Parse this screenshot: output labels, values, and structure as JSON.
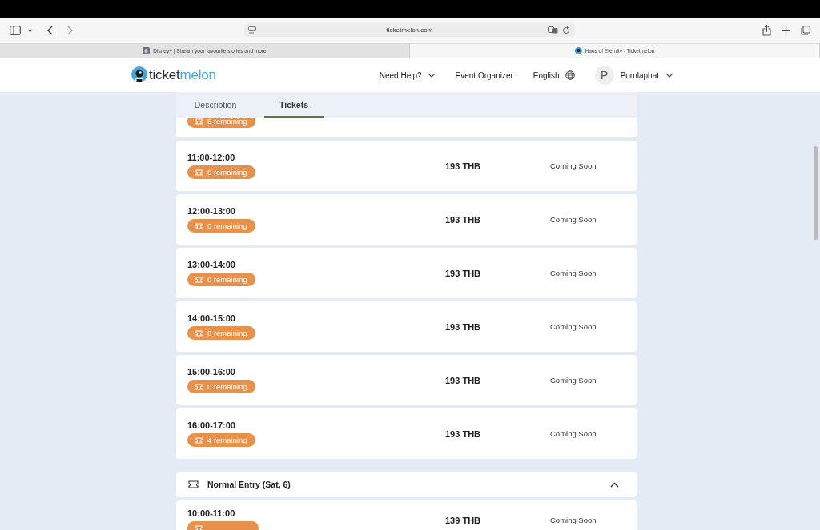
{
  "browser": {
    "url": "ticketmelon.com",
    "tabs": [
      {
        "title": "Disney+ | Stream your favourite stories and more",
        "selected": false
      },
      {
        "title": "Haus of Eternity - Ticketmelon",
        "selected": true
      }
    ]
  },
  "header": {
    "logo": [
      "ticket",
      "melon"
    ],
    "nav": [
      {
        "label": "Need Help?",
        "kind": "dropdown"
      },
      {
        "label": "Event Organizer",
        "kind": "link"
      },
      {
        "label": "English",
        "kind": "language"
      }
    ],
    "user": {
      "initial": "P",
      "name": "Pornlaphat"
    }
  },
  "page_tabs": [
    {
      "label": "Description",
      "selected": false
    },
    {
      "label": "Tickets",
      "selected": true
    }
  ],
  "sessions": [
    {
      "kind": "partial",
      "remaining": "5 remaining"
    },
    {
      "kind": "full",
      "time": "11:00-12:00",
      "remaining": "0 remaining",
      "price": "193 THB",
      "status": "Coming Soon"
    },
    {
      "kind": "full",
      "time": "12:00-13:00",
      "remaining": "0 remaining",
      "price": "193 THB",
      "status": "Coming Soon"
    },
    {
      "kind": "full",
      "time": "13:00-14:00",
      "remaining": "0 remaining",
      "price": "193 THB",
      "status": "Coming Soon"
    },
    {
      "kind": "full",
      "time": "14:00-15:00",
      "remaining": "0 remaining",
      "price": "193 THB",
      "status": "Coming Soon"
    },
    {
      "kind": "full",
      "time": "15:00-16:00",
      "remaining": "0 remaining",
      "price": "193 THB",
      "status": "Coming Soon"
    },
    {
      "kind": "full",
      "time": "16:00-17:00",
      "remaining": "4 remaining",
      "price": "193 THB",
      "status": "Coming Soon"
    }
  ],
  "section": {
    "title": "Normal Entry (Sat, 6)",
    "expanded": true,
    "sessions": [
      {
        "kind": "cut",
        "time": "10:00-11:00",
        "price": "139 THB",
        "status": "Coming Soon"
      }
    ]
  }
}
